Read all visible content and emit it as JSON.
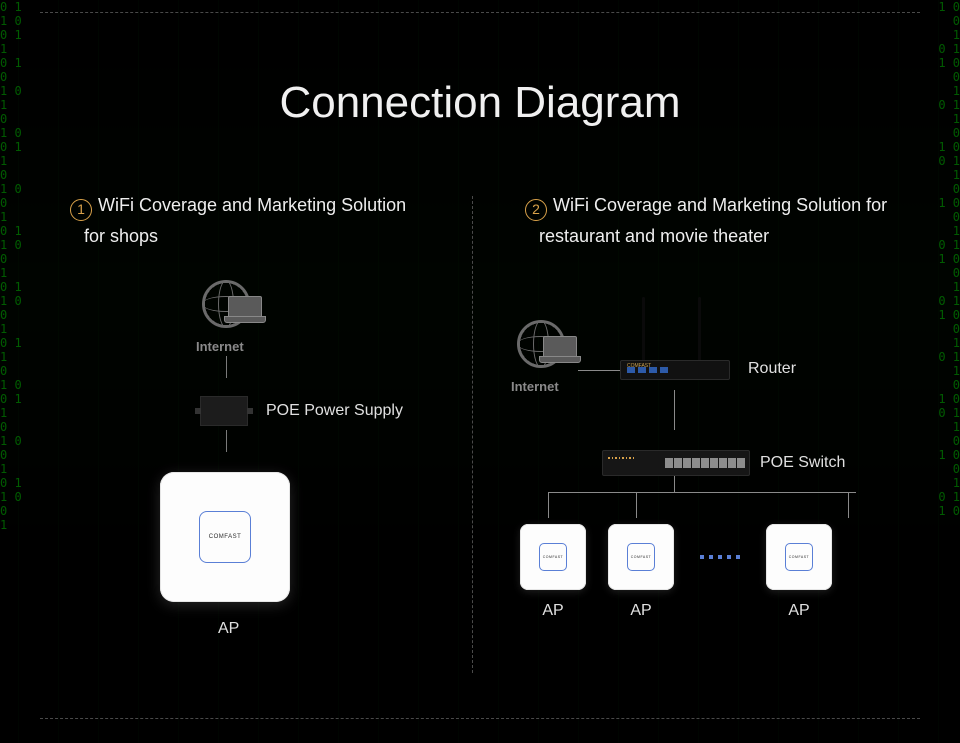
{
  "title": "Connection Diagram",
  "section1": {
    "num": "1",
    "heading": "WiFi Coverage and Marketing Solution",
    "sub": "for shops",
    "internet_label": "Internet",
    "poe_label": "POE Power Supply",
    "ap_brand": "COMFAST",
    "ap_caption": "AP"
  },
  "section2": {
    "num": "2",
    "heading": "WiFi Coverage and Marketing Solution for",
    "sub": "restaurant and movie theater",
    "internet_label": "Internet",
    "router_label": "Router",
    "switch_label": "POE Switch",
    "ap_brand": "COMFAST",
    "aps": [
      "AP",
      "AP",
      "AP"
    ]
  }
}
